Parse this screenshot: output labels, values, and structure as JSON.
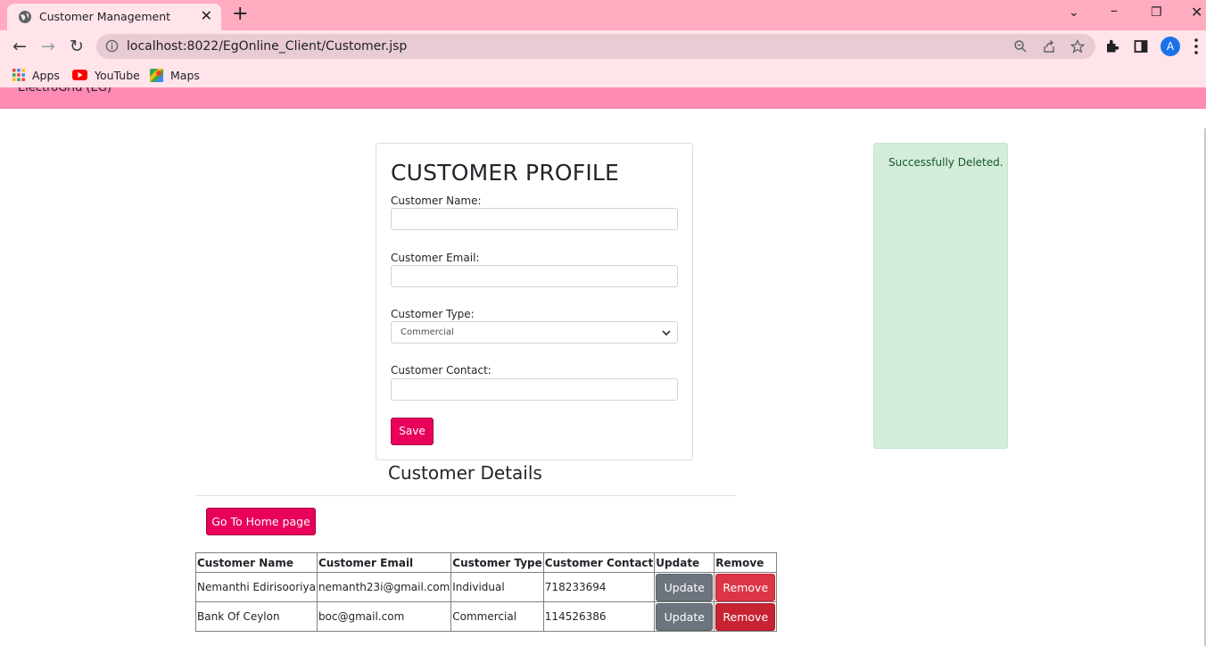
{
  "browser": {
    "tab_title": "Customer Management",
    "url": "localhost:8022/EgOnline_Client/Customer.jsp",
    "avatar_letter": "A",
    "bookmarks": [
      {
        "label": "Apps",
        "icon": "apps-grid-icon"
      },
      {
        "label": "YouTube",
        "icon": "youtube-icon"
      },
      {
        "label": "Maps",
        "icon": "maps-icon"
      }
    ]
  },
  "page": {
    "brand": "ElectroGrid (EG)"
  },
  "form": {
    "title": "CUSTOMER PROFILE",
    "name_label": "Customer Name:",
    "name_value": "",
    "email_label": "Customer Email:",
    "email_value": "",
    "type_label": "Customer Type:",
    "type_selected": "Commercial",
    "contact_label": "Customer Contact:",
    "contact_value": "",
    "save_label": "Save"
  },
  "alert": {
    "message": "Successfully Deleted."
  },
  "details": {
    "title": "Customer Details",
    "home_button": "Go To Home page",
    "columns": [
      "Customer Name",
      "Customer Email",
      "Customer Type",
      "Customer Contact",
      "Update",
      "Remove"
    ],
    "rows": [
      {
        "name": "Nemanthi Edirisooriya",
        "email": "nemanth23i@gmail.com",
        "type": "Individual",
        "contact": "718233694",
        "update": "Update",
        "remove": "Remove"
      },
      {
        "name": "Bank Of Ceylon",
        "email": "boc@gmail.com",
        "type": "Commercial",
        "contact": "114526386",
        "update": "Update",
        "remove": "Remove"
      }
    ]
  },
  "colors": {
    "accent": "#e8005a",
    "tabbar": "#ffacc0",
    "page_header": "#ff8ab4",
    "success_bg": "#d4eddb"
  }
}
